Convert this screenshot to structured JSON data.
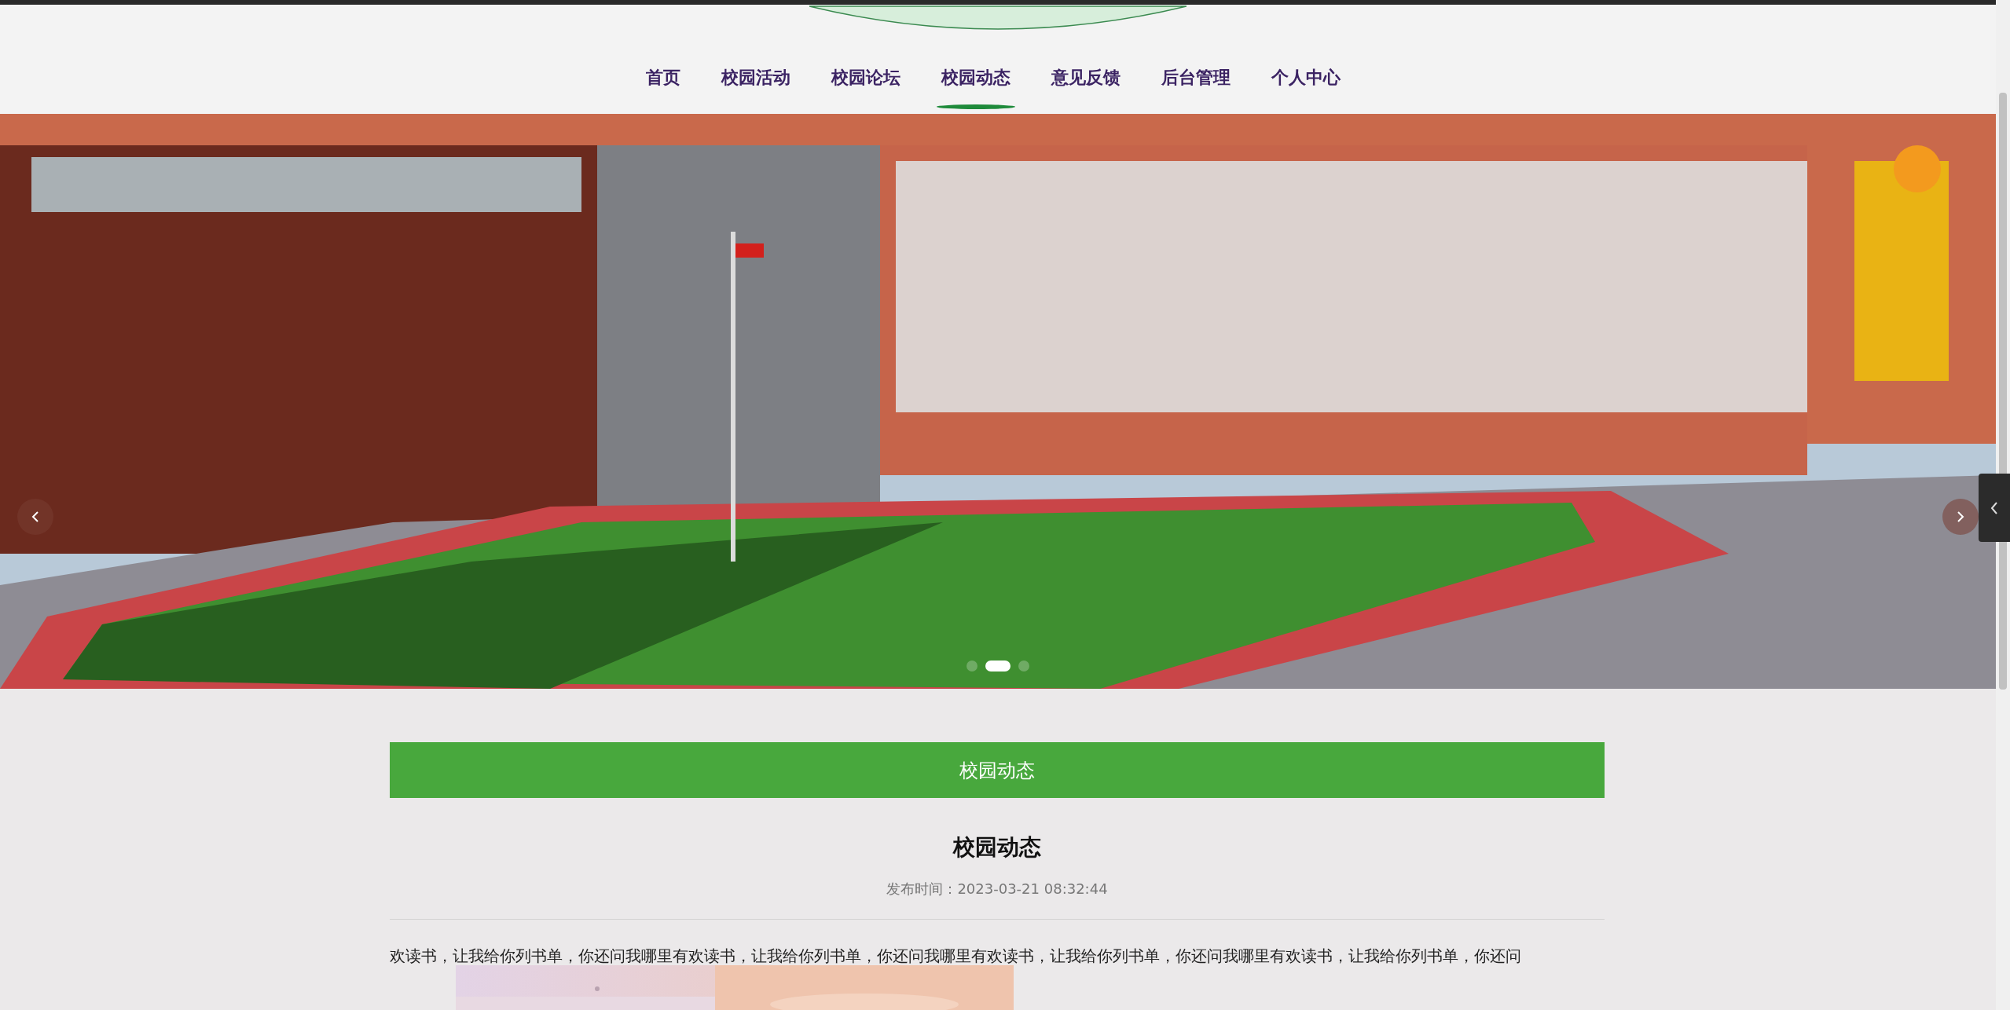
{
  "nav": {
    "items": [
      {
        "label": "首页",
        "selected": false
      },
      {
        "label": "校园活动",
        "selected": false
      },
      {
        "label": "校园论坛",
        "selected": false
      },
      {
        "label": "校园动态",
        "selected": true
      },
      {
        "label": "意见反馈",
        "selected": false
      },
      {
        "label": "后台管理",
        "selected": false
      },
      {
        "label": "个人中心",
        "selected": false
      }
    ]
  },
  "carousel": {
    "kind": "picture",
    "dots": [
      {
        "selected": false
      },
      {
        "selected": true
      },
      {
        "selected": false
      }
    ]
  },
  "section_header": "校园动态",
  "article": {
    "title": "校园动态",
    "published": "发布时间：2023-03-21 08:32:44",
    "body": "欢读书，让我给你列书单，你还问我哪里有欢读书，让我给你列书单，你还问我哪里有欢读书，让我给你列书单，你还问我哪里有欢读书，让我给你列书单，你还问"
  }
}
